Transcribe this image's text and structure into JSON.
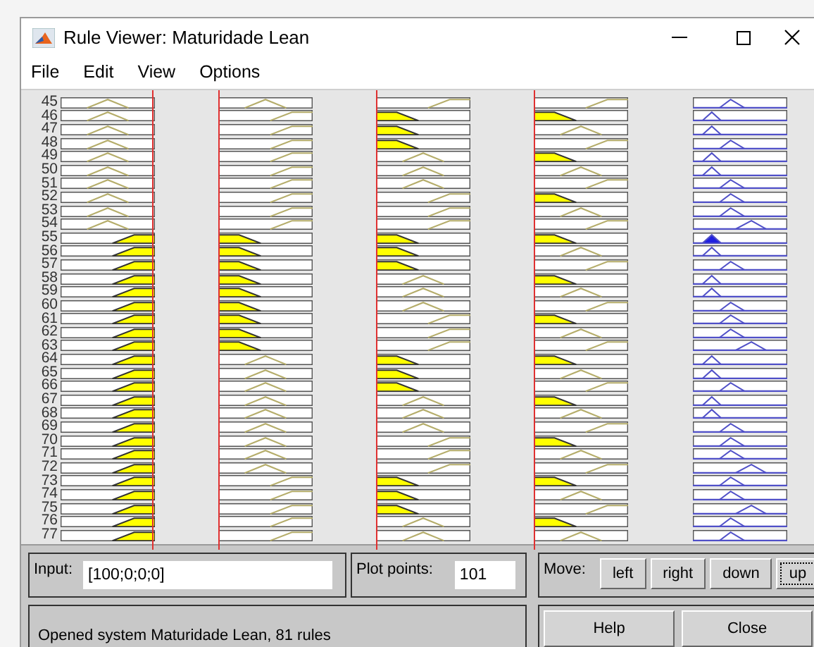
{
  "window": {
    "title": "Rule Viewer: Maturidade Lean"
  },
  "menu": [
    "File",
    "Edit",
    "View",
    "Options"
  ],
  "input_cursors": [
    {
      "level": 1
    },
    {
      "level": 0
    },
    {
      "level": 0
    },
    {
      "level": 0
    }
  ],
  "rules": [
    {
      "number": "45",
      "inputs": [
        {
          "kind": "mid",
          "active": false
        },
        {
          "kind": "mid",
          "active": false
        },
        {
          "kind": "high",
          "active": false
        },
        {
          "kind": "high",
          "active": false
        }
      ],
      "output": {
        "kind": "mid",
        "active": false
      }
    },
    {
      "number": "46",
      "inputs": [
        {
          "kind": "mid",
          "active": false
        },
        {
          "kind": "high",
          "active": false
        },
        {
          "kind": "low",
          "active": true
        },
        {
          "kind": "low",
          "active": true
        }
      ],
      "output": {
        "kind": "low",
        "active": false
      }
    },
    {
      "number": "47",
      "inputs": [
        {
          "kind": "mid",
          "active": false
        },
        {
          "kind": "high",
          "active": false
        },
        {
          "kind": "low",
          "active": true
        },
        {
          "kind": "mid",
          "active": false
        }
      ],
      "output": {
        "kind": "low",
        "active": false
      }
    },
    {
      "number": "48",
      "inputs": [
        {
          "kind": "mid",
          "active": false
        },
        {
          "kind": "high",
          "active": false
        },
        {
          "kind": "low",
          "active": true
        },
        {
          "kind": "high",
          "active": false
        }
      ],
      "output": {
        "kind": "mid",
        "active": false
      }
    },
    {
      "number": "49",
      "inputs": [
        {
          "kind": "mid",
          "active": false
        },
        {
          "kind": "high",
          "active": false
        },
        {
          "kind": "mid",
          "active": false
        },
        {
          "kind": "low",
          "active": true
        }
      ],
      "output": {
        "kind": "low",
        "active": false
      }
    },
    {
      "number": "50",
      "inputs": [
        {
          "kind": "mid",
          "active": false
        },
        {
          "kind": "high",
          "active": false
        },
        {
          "kind": "mid",
          "active": false
        },
        {
          "kind": "mid",
          "active": false
        }
      ],
      "output": {
        "kind": "low",
        "active": false
      }
    },
    {
      "number": "51",
      "inputs": [
        {
          "kind": "mid",
          "active": false
        },
        {
          "kind": "high",
          "active": false
        },
        {
          "kind": "mid",
          "active": false
        },
        {
          "kind": "high",
          "active": false
        }
      ],
      "output": {
        "kind": "mid",
        "active": false
      }
    },
    {
      "number": "52",
      "inputs": [
        {
          "kind": "mid",
          "active": false
        },
        {
          "kind": "high",
          "active": false
        },
        {
          "kind": "high",
          "active": false
        },
        {
          "kind": "low",
          "active": true
        }
      ],
      "output": {
        "kind": "mid",
        "active": false
      }
    },
    {
      "number": "53",
      "inputs": [
        {
          "kind": "mid",
          "active": false
        },
        {
          "kind": "high",
          "active": false
        },
        {
          "kind": "high",
          "active": false
        },
        {
          "kind": "mid",
          "active": false
        }
      ],
      "output": {
        "kind": "mid",
        "active": false
      }
    },
    {
      "number": "54",
      "inputs": [
        {
          "kind": "mid",
          "active": false
        },
        {
          "kind": "high",
          "active": false
        },
        {
          "kind": "high",
          "active": false
        },
        {
          "kind": "high",
          "active": false
        }
      ],
      "output": {
        "kind": "high",
        "active": false
      }
    },
    {
      "number": "55",
      "inputs": [
        {
          "kind": "high",
          "active": true
        },
        {
          "kind": "low",
          "active": true
        },
        {
          "kind": "low",
          "active": true
        },
        {
          "kind": "low",
          "active": true
        }
      ],
      "output": {
        "kind": "low",
        "active": true
      }
    },
    {
      "number": "56",
      "inputs": [
        {
          "kind": "high",
          "active": true
        },
        {
          "kind": "low",
          "active": true
        },
        {
          "kind": "low",
          "active": true
        },
        {
          "kind": "mid",
          "active": false
        }
      ],
      "output": {
        "kind": "low",
        "active": false
      }
    },
    {
      "number": "57",
      "inputs": [
        {
          "kind": "high",
          "active": true
        },
        {
          "kind": "low",
          "active": true
        },
        {
          "kind": "low",
          "active": true
        },
        {
          "kind": "high",
          "active": false
        }
      ],
      "output": {
        "kind": "mid",
        "active": false
      }
    },
    {
      "number": "58",
      "inputs": [
        {
          "kind": "high",
          "active": true
        },
        {
          "kind": "low",
          "active": true
        },
        {
          "kind": "mid",
          "active": false
        },
        {
          "kind": "low",
          "active": true
        }
      ],
      "output": {
        "kind": "low",
        "active": false
      }
    },
    {
      "number": "59",
      "inputs": [
        {
          "kind": "high",
          "active": true
        },
        {
          "kind": "low",
          "active": true
        },
        {
          "kind": "mid",
          "active": false
        },
        {
          "kind": "mid",
          "active": false
        }
      ],
      "output": {
        "kind": "low",
        "active": false
      }
    },
    {
      "number": "60",
      "inputs": [
        {
          "kind": "high",
          "active": true
        },
        {
          "kind": "low",
          "active": true
        },
        {
          "kind": "mid",
          "active": false
        },
        {
          "kind": "high",
          "active": false
        }
      ],
      "output": {
        "kind": "mid",
        "active": false
      }
    },
    {
      "number": "61",
      "inputs": [
        {
          "kind": "high",
          "active": true
        },
        {
          "kind": "low",
          "active": true
        },
        {
          "kind": "high",
          "active": false
        },
        {
          "kind": "low",
          "active": true
        }
      ],
      "output": {
        "kind": "mid",
        "active": false
      }
    },
    {
      "number": "62",
      "inputs": [
        {
          "kind": "high",
          "active": true
        },
        {
          "kind": "low",
          "active": true
        },
        {
          "kind": "high",
          "active": false
        },
        {
          "kind": "mid",
          "active": false
        }
      ],
      "output": {
        "kind": "mid",
        "active": false
      }
    },
    {
      "number": "63",
      "inputs": [
        {
          "kind": "high",
          "active": true
        },
        {
          "kind": "low",
          "active": true
        },
        {
          "kind": "high",
          "active": false
        },
        {
          "kind": "high",
          "active": false
        }
      ],
      "output": {
        "kind": "high",
        "active": false
      }
    },
    {
      "number": "64",
      "inputs": [
        {
          "kind": "high",
          "active": true
        },
        {
          "kind": "mid",
          "active": false
        },
        {
          "kind": "low",
          "active": true
        },
        {
          "kind": "low",
          "active": true
        }
      ],
      "output": {
        "kind": "low",
        "active": false
      }
    },
    {
      "number": "65",
      "inputs": [
        {
          "kind": "high",
          "active": true
        },
        {
          "kind": "mid",
          "active": false
        },
        {
          "kind": "low",
          "active": true
        },
        {
          "kind": "mid",
          "active": false
        }
      ],
      "output": {
        "kind": "low",
        "active": false
      }
    },
    {
      "number": "66",
      "inputs": [
        {
          "kind": "high",
          "active": true
        },
        {
          "kind": "mid",
          "active": false
        },
        {
          "kind": "low",
          "active": true
        },
        {
          "kind": "high",
          "active": false
        }
      ],
      "output": {
        "kind": "mid",
        "active": false
      }
    },
    {
      "number": "67",
      "inputs": [
        {
          "kind": "high",
          "active": true
        },
        {
          "kind": "mid",
          "active": false
        },
        {
          "kind": "mid",
          "active": false
        },
        {
          "kind": "low",
          "active": true
        }
      ],
      "output": {
        "kind": "low",
        "active": false
      }
    },
    {
      "number": "68",
      "inputs": [
        {
          "kind": "high",
          "active": true
        },
        {
          "kind": "mid",
          "active": false
        },
        {
          "kind": "mid",
          "active": false
        },
        {
          "kind": "mid",
          "active": false
        }
      ],
      "output": {
        "kind": "low",
        "active": false
      }
    },
    {
      "number": "69",
      "inputs": [
        {
          "kind": "high",
          "active": true
        },
        {
          "kind": "mid",
          "active": false
        },
        {
          "kind": "mid",
          "active": false
        },
        {
          "kind": "high",
          "active": false
        }
      ],
      "output": {
        "kind": "mid",
        "active": false
      }
    },
    {
      "number": "70",
      "inputs": [
        {
          "kind": "high",
          "active": true
        },
        {
          "kind": "mid",
          "active": false
        },
        {
          "kind": "high",
          "active": false
        },
        {
          "kind": "low",
          "active": true
        }
      ],
      "output": {
        "kind": "mid",
        "active": false
      }
    },
    {
      "number": "71",
      "inputs": [
        {
          "kind": "high",
          "active": true
        },
        {
          "kind": "mid",
          "active": false
        },
        {
          "kind": "high",
          "active": false
        },
        {
          "kind": "mid",
          "active": false
        }
      ],
      "output": {
        "kind": "mid",
        "active": false
      }
    },
    {
      "number": "72",
      "inputs": [
        {
          "kind": "high",
          "active": true
        },
        {
          "kind": "mid",
          "active": false
        },
        {
          "kind": "high",
          "active": false
        },
        {
          "kind": "high",
          "active": false
        }
      ],
      "output": {
        "kind": "high",
        "active": false
      }
    },
    {
      "number": "73",
      "inputs": [
        {
          "kind": "high",
          "active": true
        },
        {
          "kind": "high",
          "active": false
        },
        {
          "kind": "low",
          "active": true
        },
        {
          "kind": "low",
          "active": true
        }
      ],
      "output": {
        "kind": "mid",
        "active": false
      }
    },
    {
      "number": "74",
      "inputs": [
        {
          "kind": "high",
          "active": true
        },
        {
          "kind": "high",
          "active": false
        },
        {
          "kind": "low",
          "active": true
        },
        {
          "kind": "mid",
          "active": false
        }
      ],
      "output": {
        "kind": "mid",
        "active": false
      }
    },
    {
      "number": "75",
      "inputs": [
        {
          "kind": "high",
          "active": true
        },
        {
          "kind": "high",
          "active": false
        },
        {
          "kind": "low",
          "active": true
        },
        {
          "kind": "high",
          "active": false
        }
      ],
      "output": {
        "kind": "high",
        "active": false
      }
    },
    {
      "number": "76",
      "inputs": [
        {
          "kind": "high",
          "active": true
        },
        {
          "kind": "high",
          "active": false
        },
        {
          "kind": "mid",
          "active": false
        },
        {
          "kind": "low",
          "active": true
        }
      ],
      "output": {
        "kind": "mid",
        "active": false
      }
    },
    {
      "number": "77",
      "inputs": [
        {
          "kind": "high",
          "active": true
        },
        {
          "kind": "high",
          "active": false
        },
        {
          "kind": "mid",
          "active": false
        },
        {
          "kind": "mid",
          "active": false
        }
      ],
      "output": {
        "kind": "mid",
        "active": false
      }
    }
  ],
  "input": {
    "label": "Input:",
    "value": "[100;0;0;0]"
  },
  "plot_points": {
    "label": "Plot points:",
    "value": "101"
  },
  "move": {
    "label": "Move:",
    "buttons": [
      {
        "label": "left",
        "focused": false
      },
      {
        "label": "right",
        "focused": false
      },
      {
        "label": "down",
        "focused": false
      },
      {
        "label": "up",
        "focused": true
      }
    ]
  },
  "status": "Opened system Maturidade Lean, 81 rules",
  "buttons": [
    "Help",
    "Close"
  ]
}
